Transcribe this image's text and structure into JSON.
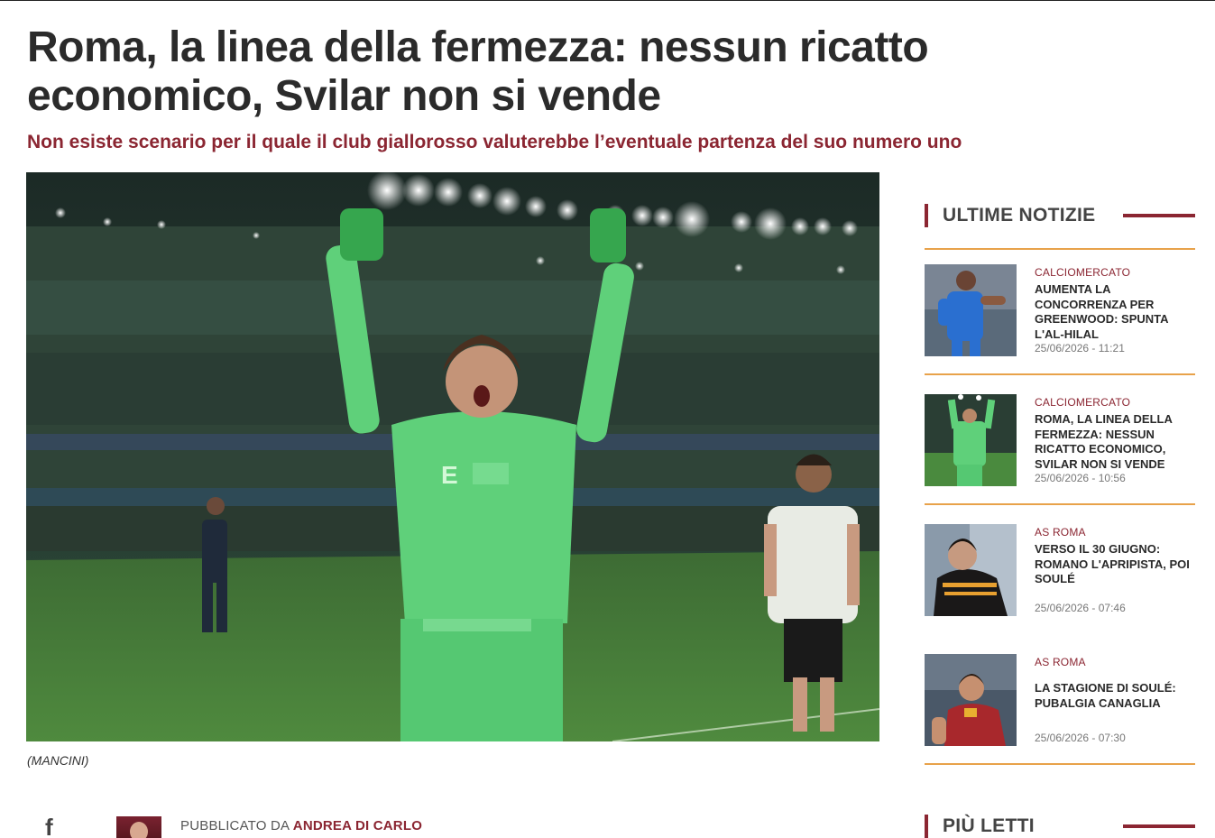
{
  "article": {
    "headline": "Roma, la linea della fermezza: nessun ricatto economico, Svilar non si vende",
    "subheadline": "Non esiste scenario per il quale il club giallorosso valuterebbe l’eventuale partenza del suo numero uno",
    "image_caption": "(MANCINI)",
    "byline_prefix": "PUBBLICATO DA",
    "author": "ANDREA DI CARLO",
    "share_icon": "facebook-icon"
  },
  "sidebar": {
    "latest_title": "ULTIME NOTIZIE",
    "most_read_title": "PIÙ LETTI",
    "items": [
      {
        "category": "CALCIOMERCATO",
        "title": "AUMENTA LA CONCORRENZA PER GREENWOOD: SPUNTA L'AL-HILAL",
        "date": "25/06/2026 - 11:21"
      },
      {
        "category": "CALCIOMERCATO",
        "title": "ROMA, LA LINEA DELLA FERMEZZA: NESSUN RICATTO ECONOMICO, SVILAR NON SI VENDE",
        "date": "25/06/2026 - 10:56"
      },
      {
        "category": "AS ROMA",
        "title": "VERSO IL 30 GIUGNO: ROMANO L'APRIPISTA, POI SOULÉ",
        "date": "25/06/2026 - 07:46"
      },
      {
        "category": "AS ROMA",
        "title": "LA STAGIONE DI SOULÉ: PUBALGIA CANAGLIA",
        "date": "25/06/2026 - 07:30"
      }
    ]
  },
  "colors": {
    "accent": "#8b2632",
    "divider": "#e8a24a",
    "text": "#2b2b2b"
  }
}
